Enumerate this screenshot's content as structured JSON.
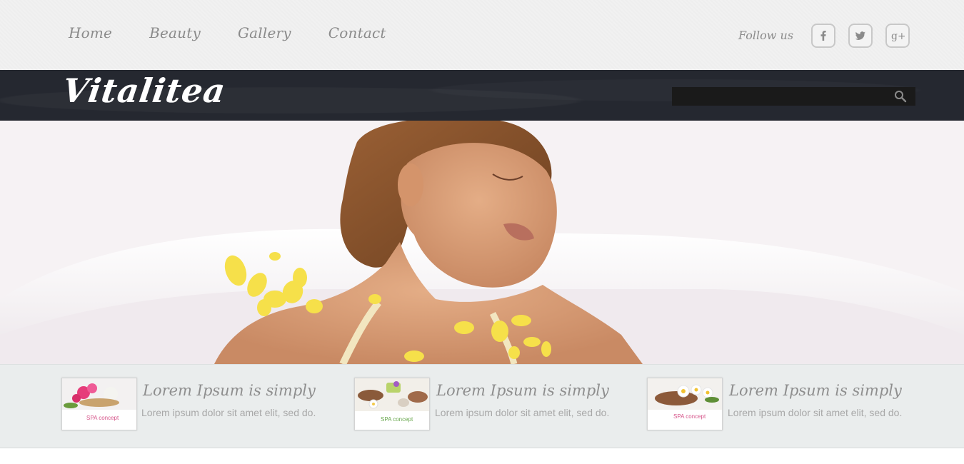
{
  "nav": {
    "items": [
      "Home",
      "Beauty",
      "Gallery",
      "Contact"
    ]
  },
  "social": {
    "follow_label": "Follow us",
    "icons": [
      "facebook-icon",
      "twitter-icon",
      "google-plus-icon"
    ]
  },
  "brand": {
    "logo": "Vitalitea"
  },
  "search": {
    "placeholder": "",
    "value": ""
  },
  "hero": {
    "image": "woman-relaxing-in-bath-with-petals"
  },
  "features": [
    {
      "thumb_caption": "SPA concept",
      "title": "Lorem Ipsum is simply",
      "text": "Lorem ipsum dolor sit amet elit, sed do."
    },
    {
      "thumb_caption": "SPA concept",
      "title": "Lorem Ipsum is simply",
      "text": "Lorem ipsum dolor sit amet elit, sed do."
    },
    {
      "thumb_caption": "SPA concept",
      "title": "Lorem Ipsum is simply",
      "text": "Lorem ipsum dolor sit amet elit, sed do."
    }
  ],
  "colors": {
    "header_dark": "#252830",
    "topbar": "#f1f1f1",
    "strip": "#eaeded",
    "text_gray": "#8b8b8b"
  }
}
